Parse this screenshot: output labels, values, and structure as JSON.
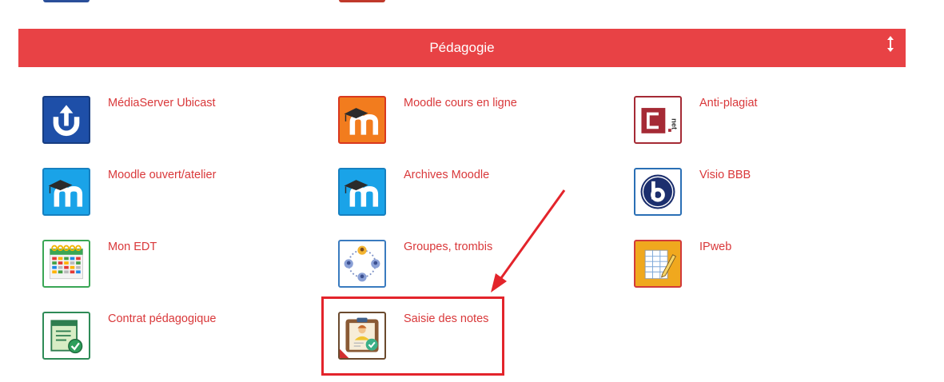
{
  "section": {
    "title": "Pédagogie",
    "toggle_icon": "vertical-resize-arrows-icon",
    "color": "#e84245"
  },
  "apps": [
    {
      "label": "MédiaServer Ubicast",
      "icon": "mediaserver-upload-icon"
    },
    {
      "label": "Moodle cours en ligne",
      "icon": "moodle-orange-icon"
    },
    {
      "label": "Anti-plagiat",
      "icon": "compilatio-net-icon"
    },
    {
      "label": "Moodle ouvert/atelier",
      "icon": "moodle-blue-icon"
    },
    {
      "label": "Archives Moodle",
      "icon": "moodle-blue-icon"
    },
    {
      "label": "Visio BBB",
      "icon": "bigbluebutton-icon"
    },
    {
      "label": "Mon EDT",
      "icon": "calendar-timetable-icon"
    },
    {
      "label": "Groupes, trombis",
      "icon": "group-network-icon"
    },
    {
      "label": "IPweb",
      "icon": "spreadsheet-pencil-icon"
    },
    {
      "label": "Contrat pédagogique",
      "icon": "contract-check-icon"
    },
    {
      "label": "Saisie des notes",
      "icon": "clipboard-grade-icon"
    }
  ],
  "annotation": {
    "color": "#e3242b",
    "target": "Saisie des notes"
  }
}
